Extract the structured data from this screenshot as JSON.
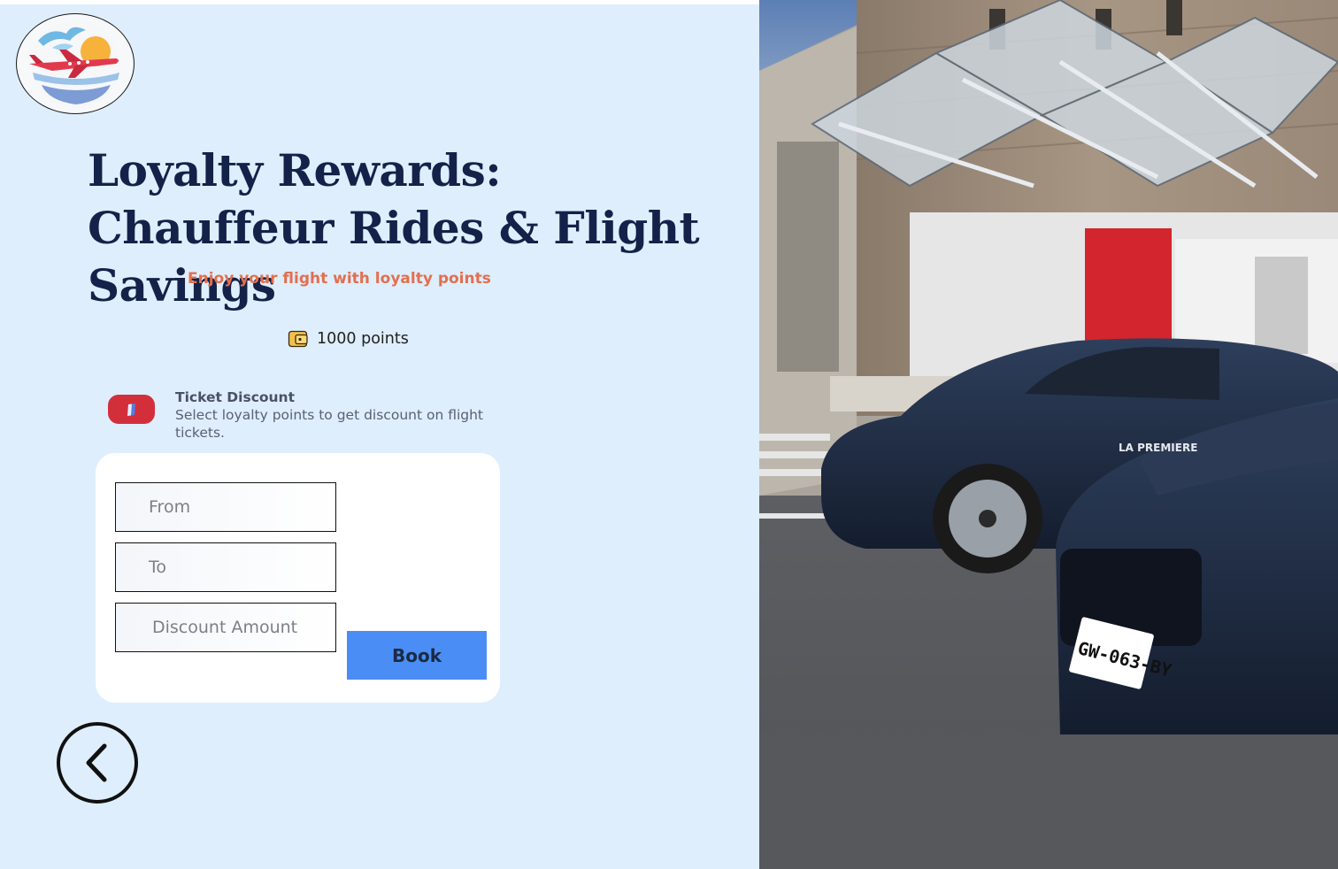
{
  "page": {
    "title": "Loyalty Rewards: Chauffeur Rides & Flight Savings",
    "subtitle": "Enjoy your flight with loyalty points"
  },
  "points": {
    "icon": "wallet-icon",
    "label": "1000 points"
  },
  "ticket_discount": {
    "icon": "ticket-icon",
    "title": "Ticket Discount",
    "description": "Select loyalty points to get discount on flight tickets."
  },
  "form": {
    "from_placeholder": "From",
    "to_placeholder": "To",
    "discount_placeholder": "Discount Amount",
    "book_label": "Book"
  },
  "navigation": {
    "back_icon": "chevron-left-icon"
  },
  "photo": {
    "plate_text": "GW-063-BY",
    "sign_text": "LA PREMIERE"
  },
  "colors": {
    "panel_background": "#deeefc",
    "title": "#14224a",
    "subtitle": "#e36f4f",
    "ticket_badge": "#d32f3b",
    "book_button": "#4a8ef5"
  }
}
